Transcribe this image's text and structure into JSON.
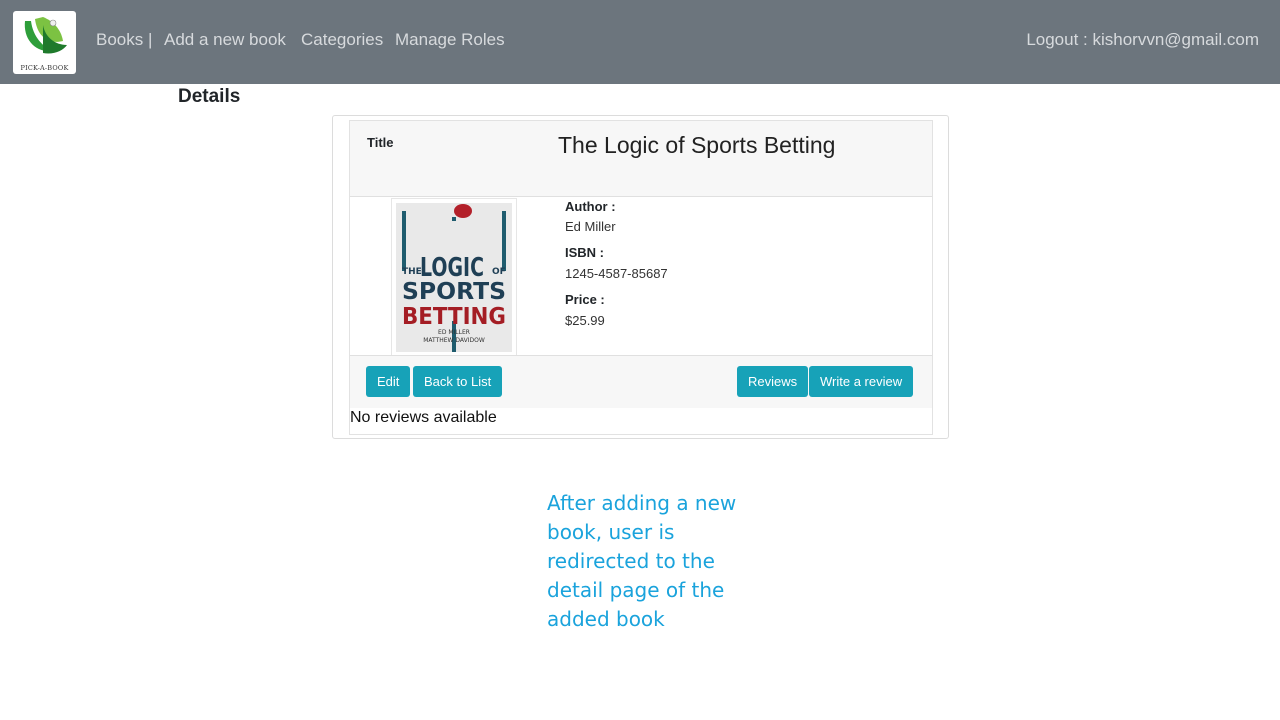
{
  "navbar": {
    "logo_text": "PICK-A-BOOK",
    "books": "Books |",
    "add_book": "Add a new book",
    "categories": "Categories",
    "manage_roles": "Manage Roles",
    "logout": "Logout : kishorvvn@gmail.com"
  },
  "page": {
    "heading": "Details"
  },
  "book": {
    "title_label": "Title",
    "title": "The Logic of Sports Betting",
    "author_label": "Author :",
    "author": "Ed Miller",
    "isbn_label": "ISBN :",
    "isbn": "1245-4587-85687",
    "price_label": "Price :",
    "price": "$25.99",
    "cover": {
      "line_the": "THE",
      "line_logic": "LOGIC",
      "line_of": "OF",
      "line_sports": "SPORTS",
      "line_betting": "BETTING",
      "author1": "ED MILLER",
      "author2": "MATTHEW DAVIDOW"
    }
  },
  "actions": {
    "edit": "Edit",
    "back": "Back to List",
    "reviews": "Reviews",
    "write_review": "Write a review"
  },
  "reviews": {
    "empty": "No reviews available"
  },
  "annotation": {
    "text": "After adding a new book, user is redirected to the detail page of the added book"
  },
  "colors": {
    "navbar": "#6c757d",
    "button": "#17a2b8",
    "annotation": "#1aa3dc"
  }
}
